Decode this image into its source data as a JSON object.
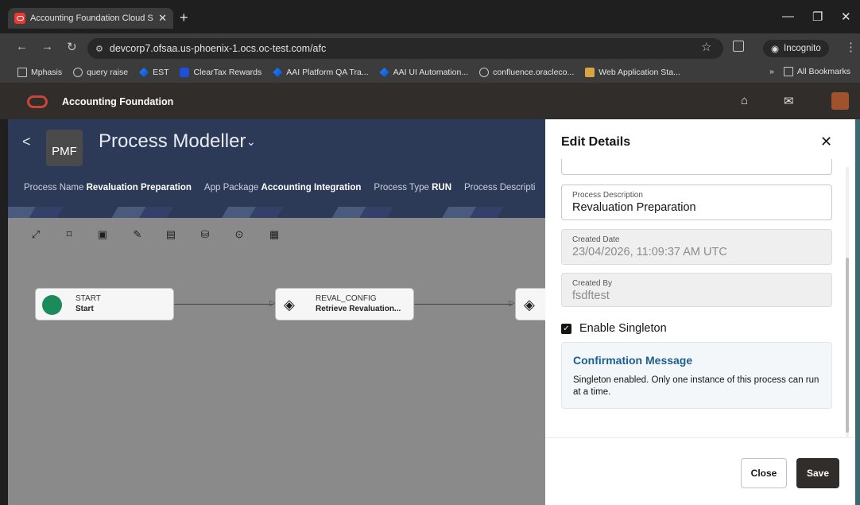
{
  "browser": {
    "tab_title": "Accounting Foundation Cloud S",
    "url": "devcorp7.ofsaa.us-phoenix-1.ocs.oc-test.com/afc",
    "incognito_label": "Incognito",
    "bookmarks": [
      {
        "label": "Mphasis",
        "icon": "folder-icon"
      },
      {
        "label": "query raise",
        "icon": "globe-icon"
      },
      {
        "label": "EST",
        "icon": "jira-icon"
      },
      {
        "label": "ClearTax Rewards",
        "icon": "cleartax-icon"
      },
      {
        "label": "AAI Platform QA Tra...",
        "icon": "jira-icon"
      },
      {
        "label": "AAI UI Automation...",
        "icon": "jira-icon"
      },
      {
        "label": "confluence.oracleco...",
        "icon": "globe-icon"
      },
      {
        "label": "Web Application Sta...",
        "icon": "web-app-icon"
      }
    ],
    "all_bookmarks_label": "All Bookmarks"
  },
  "app": {
    "title": "Accounting Foundation"
  },
  "banner": {
    "badge": "PMF",
    "title": "Process Modeller",
    "meta": [
      {
        "key": "Process Name",
        "value": "Revaluation Preparation"
      },
      {
        "key": "App Package",
        "value": "Accounting Integration"
      },
      {
        "key": "Process Type",
        "value": "RUN"
      },
      {
        "key": "Process Descripti",
        "value": ""
      }
    ]
  },
  "canvas": {
    "nodes": [
      {
        "type": "START",
        "label": "Start"
      },
      {
        "type": "REVAL_CONFIG",
        "label": "Retrieve Revaluation..."
      }
    ]
  },
  "drawer": {
    "title": "Edit Details",
    "fields": {
      "description": {
        "label": "Process Description",
        "value": "Revaluation Preparation"
      },
      "created_date": {
        "label": "Created Date",
        "value": "23/04/2026, 11:09:37 AM UTC"
      },
      "created_by": {
        "label": "Created By",
        "value": "fsdftest"
      }
    },
    "checkbox_label": "Enable Singleton",
    "checkbox_checked": true,
    "message": {
      "title": "Confirmation Message",
      "body": "Singleton enabled. Only one instance of this process can run at a time."
    },
    "close_label": "Close",
    "save_label": "Save"
  },
  "colors": {
    "header_bg": "#312d2a",
    "banner_bg": "#2d3a57",
    "oracle_red": "#c74634",
    "message_title": "#1b5f8c",
    "start_node": "#1d8a5c"
  }
}
